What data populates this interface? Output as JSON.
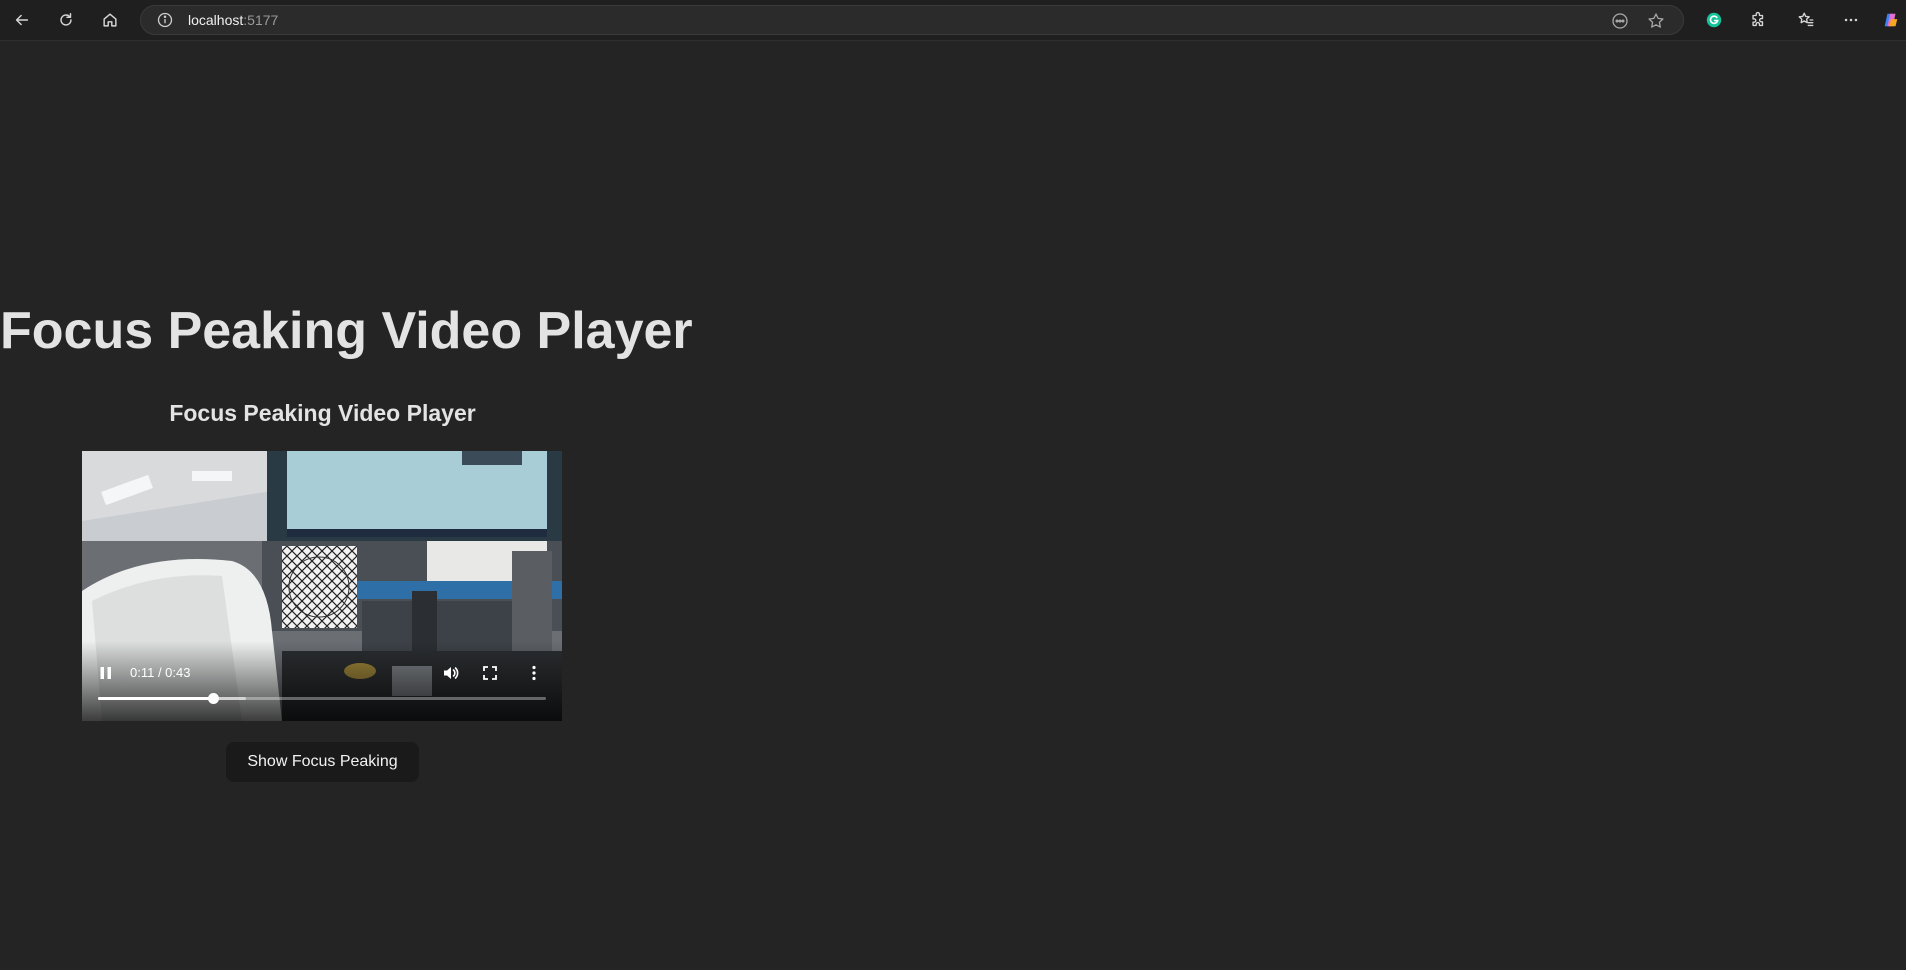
{
  "browser": {
    "url_host": "localhost",
    "url_port": ":5177",
    "icons": [
      "back-icon",
      "refresh-icon",
      "home-icon",
      "site-info-icon",
      "reader-icon",
      "favorite-star-icon",
      "grammarly-icon",
      "extensions-icon",
      "favorites-icon",
      "more-icon",
      "copilot-icon"
    ]
  },
  "page": {
    "title": "Focus Peaking Video Player",
    "subtitle": "Focus Peaking Video Player"
  },
  "video": {
    "time_display": "0:11 / 0:43",
    "current_seconds": 11,
    "duration_seconds": 43,
    "buffered_fraction": 0.33,
    "playing": true
  },
  "actions": {
    "focus_button_label": "Show Focus Peaking"
  },
  "colors": {
    "background": "#242424",
    "text": "#e3e3e3",
    "button_bg": "#1a1a1a"
  }
}
